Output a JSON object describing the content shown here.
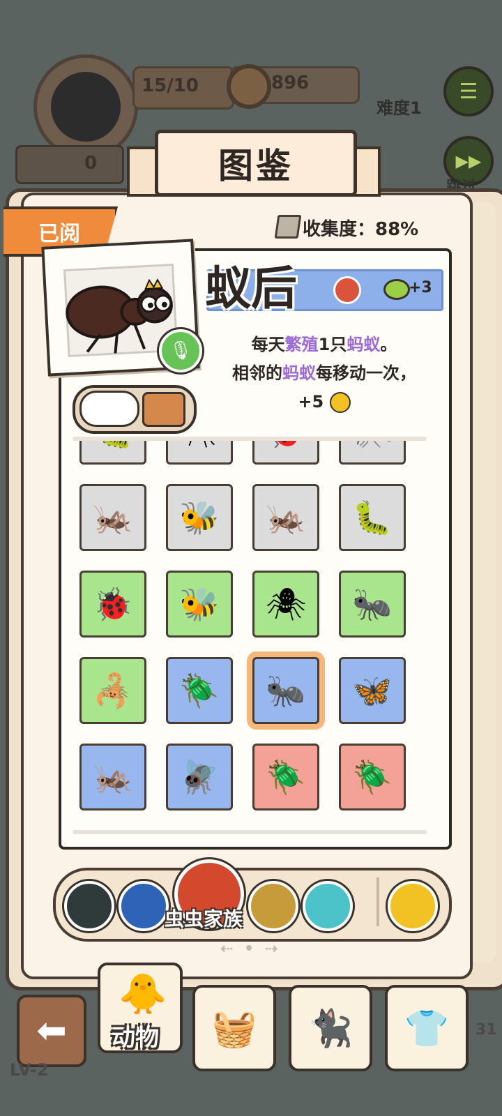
{
  "hud": {
    "progress": "15/10",
    "coins": "896",
    "zero": "0",
    "difficulty": "难度1",
    "skip": "跳过",
    "level": "LV-2",
    "side_num": "31"
  },
  "book": {
    "title": "图鉴",
    "read_tag": "已阅",
    "collect": "收集度：88%"
  },
  "detail": {
    "name": "蚁后",
    "leaf_bonus": "+3",
    "desc_line1_pre": "每天",
    "desc_line1_hl": "繁殖",
    "desc_line1_mid": "1只",
    "desc_line1_hl2": "蚂蚁",
    "desc_line1_post": "。",
    "desc_line2_pre": "相邻的",
    "desc_line2_hl": "蚂蚁",
    "desc_line2_post": "每移动一次，",
    "desc_line3": "+5"
  },
  "grid": [
    {
      "color": "gray",
      "icon": "🐛"
    },
    {
      "color": "gray",
      "icon": "🕷"
    },
    {
      "color": "gray",
      "icon": "🐞"
    },
    {
      "color": "gray",
      "icon": "🦟"
    },
    {
      "color": "gray",
      "icon": "🦗"
    },
    {
      "color": "gray",
      "icon": "🐝"
    },
    {
      "color": "gray",
      "icon": "🦗"
    },
    {
      "color": "gray",
      "icon": "🐛"
    },
    {
      "color": "green",
      "icon": "🐞"
    },
    {
      "color": "green",
      "icon": "🐝"
    },
    {
      "color": "green",
      "icon": "🕷"
    },
    {
      "color": "green",
      "icon": "🐜"
    },
    {
      "color": "green",
      "icon": "🦂"
    },
    {
      "color": "blue",
      "icon": "🪲"
    },
    {
      "color": "blue",
      "icon": "🐜",
      "selected": true
    },
    {
      "color": "blue",
      "icon": "🦋"
    },
    {
      "color": "blue",
      "icon": "🦗"
    },
    {
      "color": "blue",
      "icon": "🪰"
    },
    {
      "color": "red",
      "icon": "🪲"
    },
    {
      "color": "red",
      "icon": "🪲"
    }
  ],
  "categories": {
    "active_label": "虫虫家族",
    "items": [
      {
        "color": "#2f3b3a"
      },
      {
        "color": "#2f63b8"
      },
      {
        "color": "#c79a3a"
      },
      {
        "color": "#4cc3c9"
      },
      {
        "color": "#f2c224"
      }
    ]
  },
  "nav": {
    "animal_label": "动物"
  }
}
